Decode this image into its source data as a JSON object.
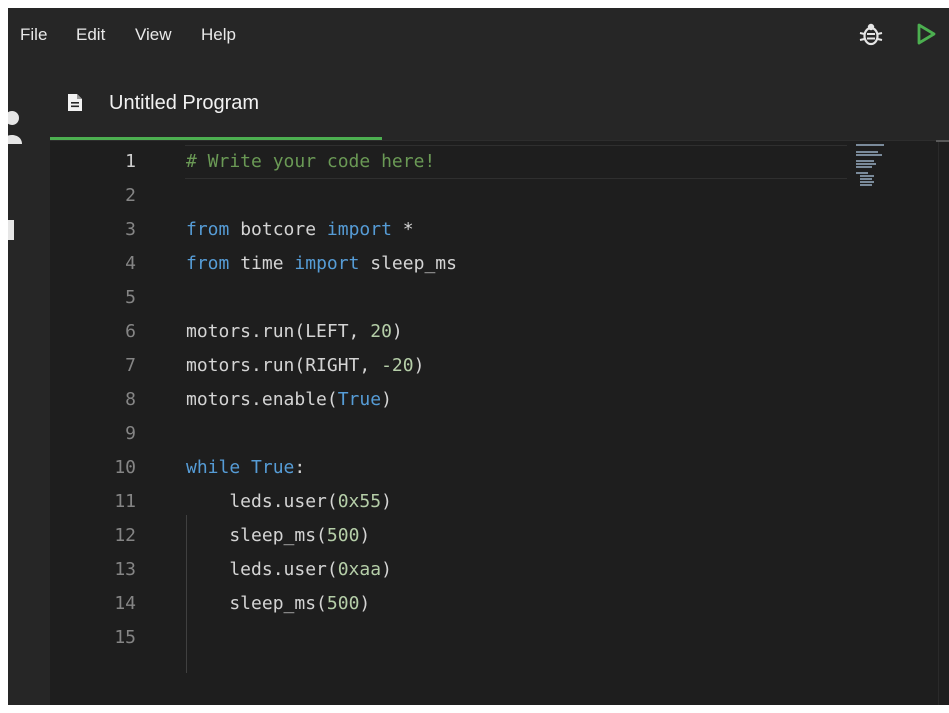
{
  "menu": {
    "items": [
      "File",
      "Edit",
      "View",
      "Help"
    ]
  },
  "toolbar": {
    "debug_icon": "bug-icon",
    "run_icon": "play-icon",
    "run_color": "#4caf50"
  },
  "tab": {
    "label": "Untitled Program",
    "icon": "file-document-icon",
    "accent": "#4caf50"
  },
  "editor": {
    "active_line": 1,
    "lines": [
      {
        "num": "1",
        "tokens": [
          {
            "t": "comment",
            "v": "# Write your code here!"
          }
        ]
      },
      {
        "num": "2",
        "tokens": []
      },
      {
        "num": "3",
        "tokens": [
          {
            "t": "keyword",
            "v": "from"
          },
          {
            "t": "plain",
            "v": " botcore "
          },
          {
            "t": "keyword",
            "v": "import"
          },
          {
            "t": "plain",
            "v": " *"
          }
        ]
      },
      {
        "num": "4",
        "tokens": [
          {
            "t": "keyword",
            "v": "from"
          },
          {
            "t": "plain",
            "v": " time "
          },
          {
            "t": "keyword",
            "v": "import"
          },
          {
            "t": "plain",
            "v": " sleep_ms"
          }
        ]
      },
      {
        "num": "5",
        "tokens": []
      },
      {
        "num": "6",
        "tokens": [
          {
            "t": "plain",
            "v": "motors.run(LEFT, "
          },
          {
            "t": "number",
            "v": "20"
          },
          {
            "t": "plain",
            "v": ")"
          }
        ]
      },
      {
        "num": "7",
        "tokens": [
          {
            "t": "plain",
            "v": "motors.run(RIGHT, "
          },
          {
            "t": "number",
            "v": "-20"
          },
          {
            "t": "plain",
            "v": ")"
          }
        ]
      },
      {
        "num": "8",
        "tokens": [
          {
            "t": "plain",
            "v": "motors.enable("
          },
          {
            "t": "keyword",
            "v": "True"
          },
          {
            "t": "plain",
            "v": ")"
          }
        ]
      },
      {
        "num": "9",
        "tokens": []
      },
      {
        "num": "10",
        "tokens": [
          {
            "t": "keyword",
            "v": "while"
          },
          {
            "t": "plain",
            "v": " "
          },
          {
            "t": "keyword",
            "v": "True"
          },
          {
            "t": "plain",
            "v": ":"
          }
        ]
      },
      {
        "num": "11",
        "tokens": [
          {
            "t": "plain",
            "v": "    leds.user("
          },
          {
            "t": "number",
            "v": "0x55"
          },
          {
            "t": "plain",
            "v": ")"
          }
        ]
      },
      {
        "num": "12",
        "tokens": [
          {
            "t": "plain",
            "v": "    sleep_ms("
          },
          {
            "t": "number",
            "v": "500"
          },
          {
            "t": "plain",
            "v": ")"
          }
        ]
      },
      {
        "num": "13",
        "tokens": [
          {
            "t": "plain",
            "v": "    leds.user("
          },
          {
            "t": "number",
            "v": "0xaa"
          },
          {
            "t": "plain",
            "v": ")"
          }
        ]
      },
      {
        "num": "14",
        "tokens": [
          {
            "t": "plain",
            "v": "    sleep_ms("
          },
          {
            "t": "number",
            "v": "500"
          },
          {
            "t": "plain",
            "v": ")"
          }
        ]
      },
      {
        "num": "15",
        "tokens": []
      }
    ]
  },
  "side": {
    "icons": [
      "user-icon",
      "panel-icon"
    ]
  }
}
